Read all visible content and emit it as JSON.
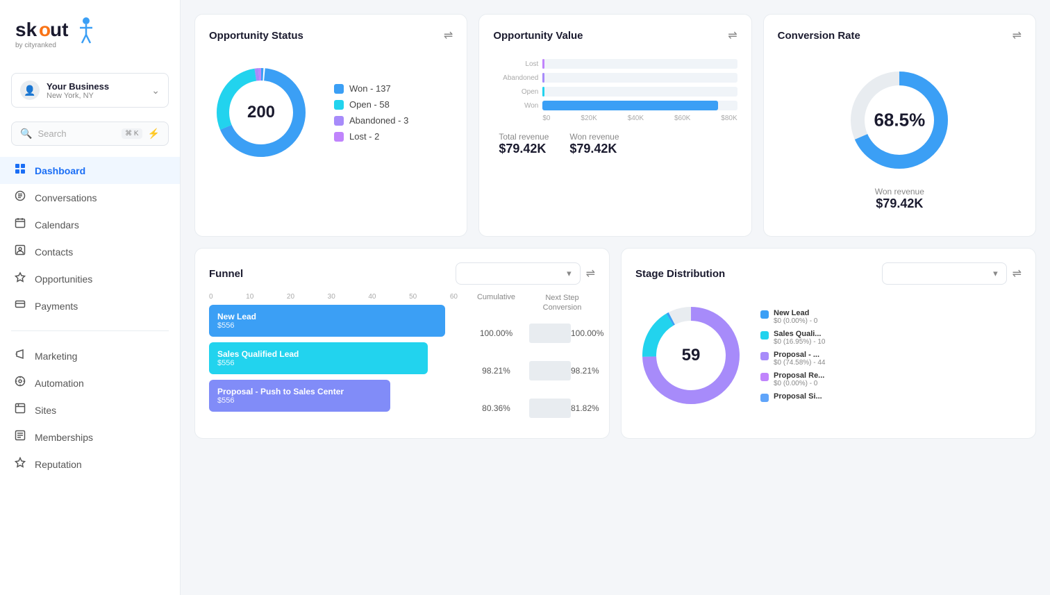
{
  "sidebar": {
    "logo_text": "skout by cityranked",
    "business": {
      "name": "Your Business",
      "location": "New York, NY"
    },
    "search": {
      "placeholder": "Search",
      "kbd": "⌘ K"
    },
    "nav_items": [
      {
        "id": "dashboard",
        "label": "Dashboard",
        "icon": "⊞",
        "active": true
      },
      {
        "id": "conversations",
        "label": "Conversations",
        "icon": "○"
      },
      {
        "id": "calendars",
        "label": "Calendars",
        "icon": "▦"
      },
      {
        "id": "contacts",
        "label": "Contacts",
        "icon": "◫"
      },
      {
        "id": "opportunities",
        "label": "Opportunities",
        "icon": "✦"
      },
      {
        "id": "payments",
        "label": "Payments",
        "icon": "▣"
      }
    ],
    "nav_items2": [
      {
        "id": "marketing",
        "label": "Marketing",
        "icon": "◁"
      },
      {
        "id": "automation",
        "label": "Automation",
        "icon": "⊙"
      },
      {
        "id": "sites",
        "label": "Sites",
        "icon": "▣"
      },
      {
        "id": "memberships",
        "label": "Memberships",
        "icon": "⊟"
      },
      {
        "id": "reputation",
        "label": "Reputation",
        "icon": "☆"
      }
    ]
  },
  "cards": {
    "opportunity_status": {
      "title": "Opportunity Status",
      "total": "200",
      "legend": [
        {
          "label": "Won - 137",
          "color": "#3b9ff5"
        },
        {
          "label": "Open - 58",
          "color": "#22d3ee"
        },
        {
          "label": "Abandoned - 3",
          "color": "#a78bfa"
        },
        {
          "label": "Lost - 2",
          "color": "#c084fc"
        }
      ],
      "donut_segments": [
        {
          "value": 137,
          "color": "#3b9ff5",
          "pct": 68.5
        },
        {
          "value": 58,
          "color": "#22d3ee",
          "pct": 29
        },
        {
          "value": 3,
          "color": "#a78bfa",
          "pct": 1.5
        },
        {
          "value": 2,
          "color": "#c084fc",
          "pct": 1
        }
      ]
    },
    "opportunity_value": {
      "title": "Opportunity Value",
      "bars": [
        {
          "label": "Won",
          "value": 79420,
          "max": 80000,
          "color": "#3b9ff5"
        },
        {
          "label": "Open",
          "value": 0,
          "max": 80000,
          "color": "#22d3ee"
        },
        {
          "label": "Abandoned",
          "value": 0,
          "max": 80000,
          "color": "#a78bfa"
        },
        {
          "label": "Lost",
          "value": 0,
          "max": 80000,
          "color": "#e0e4ea"
        }
      ],
      "x_labels": [
        "$0",
        "$20K",
        "$40K",
        "$60K",
        "$80K"
      ],
      "total_revenue_label": "Total revenue",
      "total_revenue_value": "$79.42K",
      "won_revenue_label": "Won revenue",
      "won_revenue_value": "$79.42K"
    },
    "conversion_rate": {
      "title": "Conversion Rate",
      "value": "68.5%",
      "won_revenue_label": "Won revenue",
      "won_revenue_value": "$79.42K"
    },
    "funnel": {
      "title": "Funnel",
      "dropdown_placeholder": "",
      "x_labels": [
        "0",
        "10",
        "20",
        "30",
        "40",
        "50",
        "60"
      ],
      "col_headers": [
        "Cumulative",
        "Next Step\nConversion"
      ],
      "rows": [
        {
          "label": "New Lead",
          "value": "$556",
          "color": "#3b9ff5",
          "width_pct": 95,
          "cumulative": "100.00%",
          "next_step": "100.00%"
        },
        {
          "label": "Sales Qualified Lead",
          "value": "$556",
          "color": "#22d3ee",
          "width_pct": 90,
          "cumulative": "98.21%",
          "next_step": "98.21%"
        },
        {
          "label": "Proposal - Push to Sales Center",
          "value": "$556",
          "color": "#818cf8",
          "width_pct": 75,
          "cumulative": "80.36%",
          "next_step": "81.82%"
        }
      ]
    },
    "stage_distribution": {
      "title": "Stage Distribution",
      "center_value": "59",
      "legend": [
        {
          "label": "New Lead",
          "sub": "$0 (0.00%) - 0",
          "color": "#3b9ff5"
        },
        {
          "label": "Sales Quali...",
          "sub": "$0 (16.95%) - 10",
          "color": "#22d3ee"
        },
        {
          "label": "Proposal - ...",
          "sub": "$0 (74.58%) - 44",
          "color": "#a78bfa"
        },
        {
          "label": "Proposal Re...",
          "sub": "$0 (0.00%) - 0",
          "color": "#c084fc"
        },
        {
          "label": "Proposal Si...",
          "sub": "",
          "color": "#60a5fa"
        }
      ]
    }
  }
}
